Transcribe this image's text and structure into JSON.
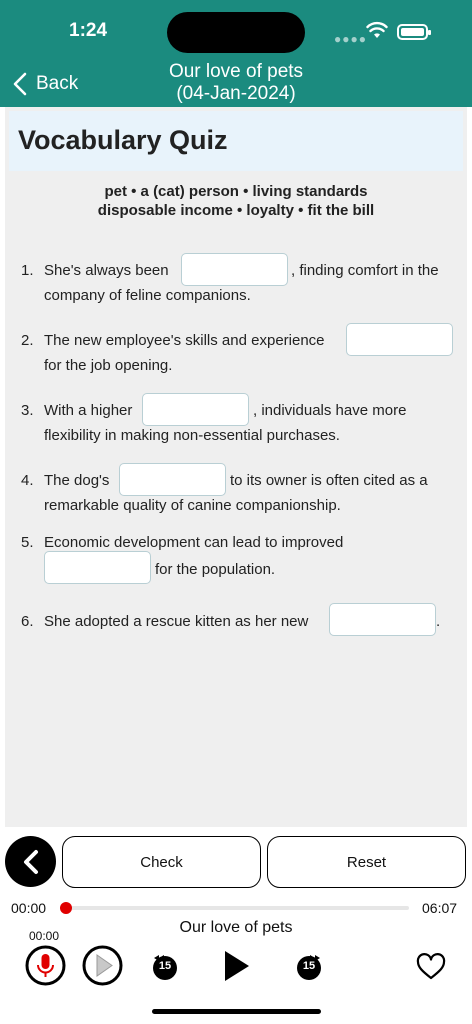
{
  "status": {
    "time": "1:24"
  },
  "nav": {
    "back_label": "Back",
    "title_line1": "Our love of pets",
    "title_line2": "(04-Jan-2024)"
  },
  "quiz": {
    "title": "Vocabulary Quiz",
    "word_bank_line1": "pet • a (cat) person • living standards",
    "word_bank_line2": "disposable income • loyalty • fit the bill",
    "questions": [
      {
        "num": "1.",
        "before": "She's always been",
        "after": ", finding comfort in the",
        "line2": "company of feline companions."
      },
      {
        "num": "2.",
        "before": "The new employee's skills and experience",
        "line2": "for the job opening."
      },
      {
        "num": "3.",
        "before": "With a higher",
        "after": ", individuals have more",
        "line2": "flexibility in making non-essential purchases."
      },
      {
        "num": "4.",
        "before": "The dog's",
        "after": "to its owner is often cited as a",
        "line2": "remarkable quality of canine companionship."
      },
      {
        "num": "5.",
        "before": "Economic development can lead to improved",
        "after": "for the population."
      },
      {
        "num": "6.",
        "before": "She adopted a rescue kitten as her new",
        "after": "."
      }
    ]
  },
  "actions": {
    "check_label": "Check",
    "reset_label": "Reset"
  },
  "player": {
    "elapsed": "00:00",
    "duration": "06:07",
    "progress": 0,
    "track_title": "Our love of pets",
    "record_time": "00:00",
    "skip_back_seconds": "15",
    "skip_forward_seconds": "15"
  },
  "colors": {
    "header": "#1b8b7f",
    "record_accent": "#e00000"
  }
}
